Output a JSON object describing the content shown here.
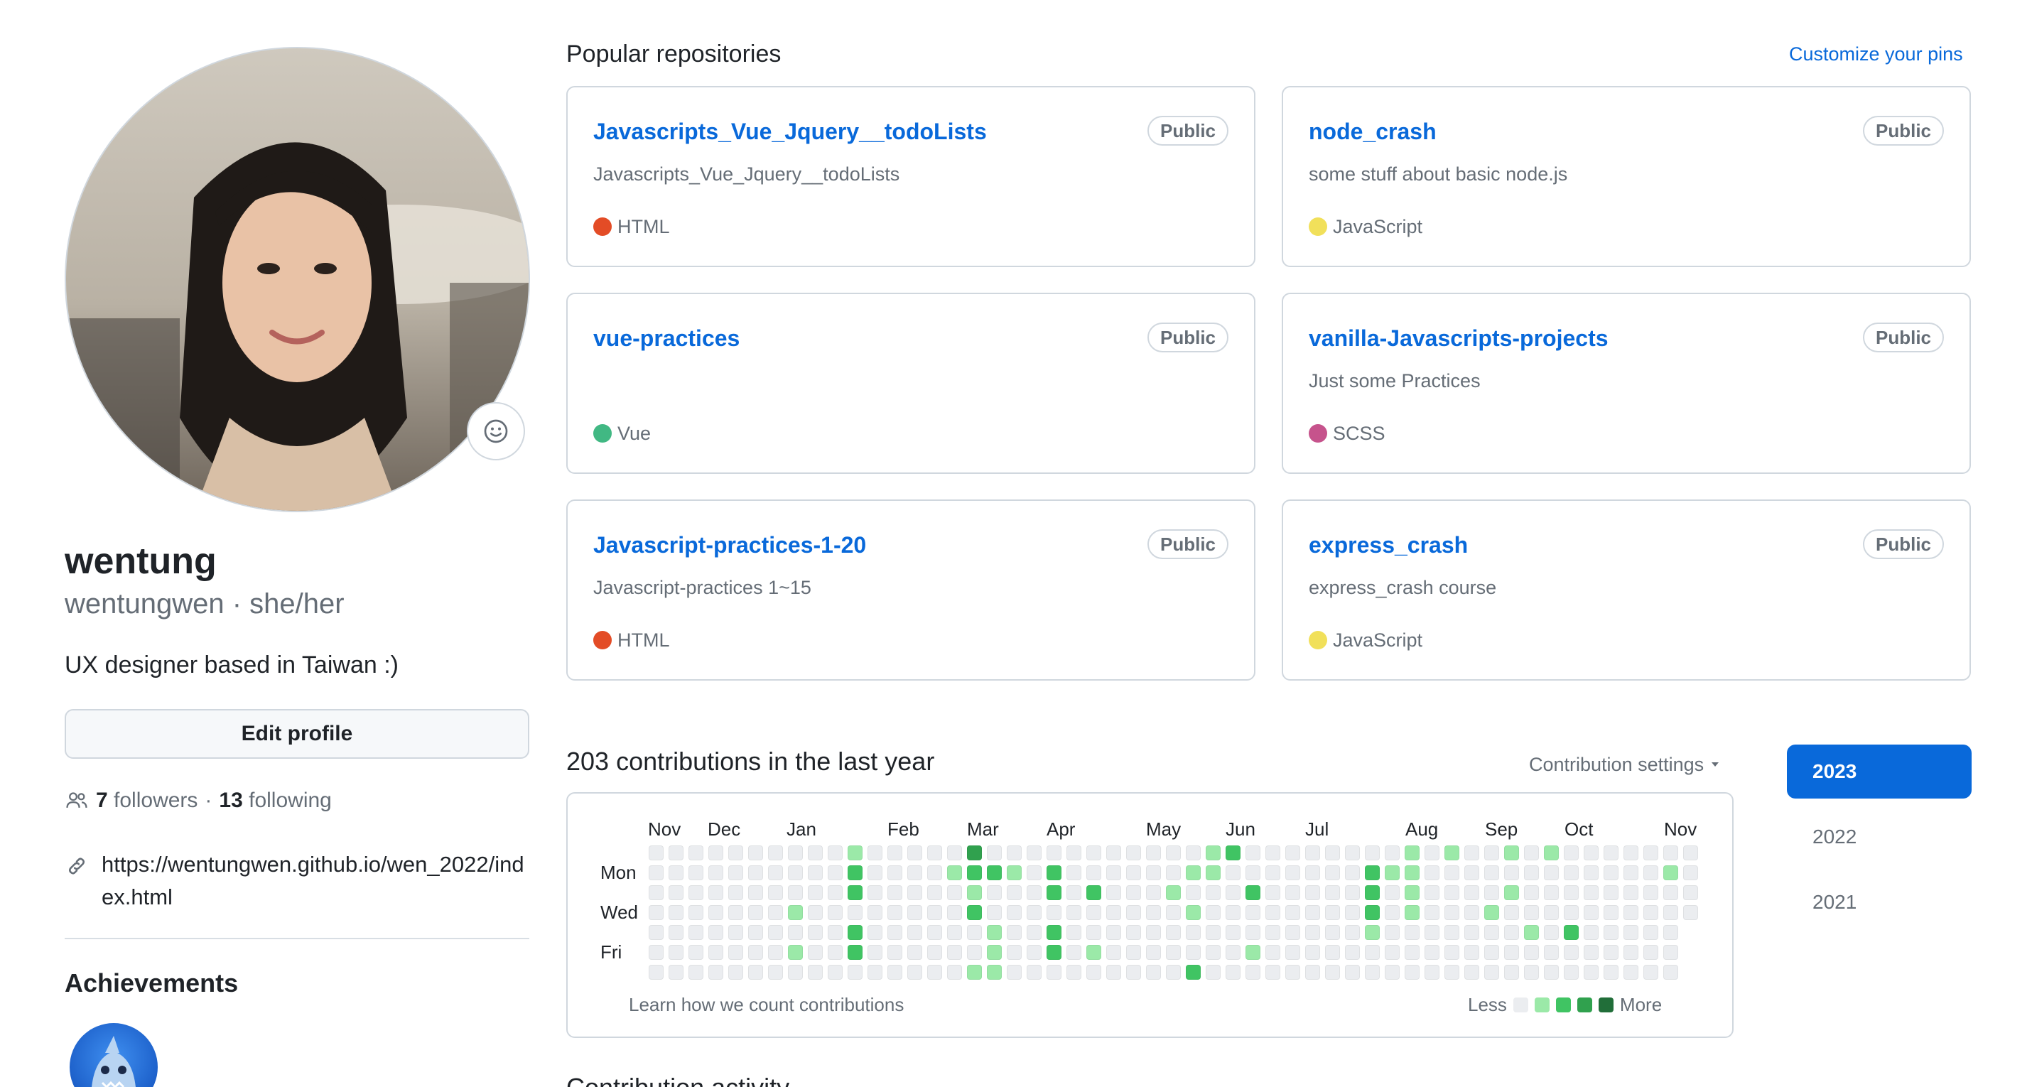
{
  "profile": {
    "name": "wentung",
    "login_line": "wentungwen · she/her",
    "bio": "UX designer based in Taiwan :)",
    "edit_label": "Edit profile",
    "followers_count": "7",
    "followers_label": "followers",
    "separator": "·",
    "following_count": "13",
    "following_label": "following",
    "website": "https://wentungwen.github.io/wen_2022/index.html",
    "achievements_title": "Achievements"
  },
  "popular": {
    "title": "Popular repositories",
    "customize_label": "Customize your pins",
    "repos": [
      {
        "name": "Javascripts_Vue_Jquery__todoLists",
        "visibility": "Public",
        "description": "Javascripts_Vue_Jquery__todoLists",
        "language": "HTML",
        "lang_color": "#e34c26"
      },
      {
        "name": "node_crash",
        "visibility": "Public",
        "description": "some stuff about basic node.js",
        "language": "JavaScript",
        "lang_color": "#f1e05a"
      },
      {
        "name": "vue-practices",
        "visibility": "Public",
        "description": "",
        "language": "Vue",
        "lang_color": "#41b883"
      },
      {
        "name": "vanilla-Javascripts-projects",
        "visibility": "Public",
        "description": "Just some Practices",
        "language": "SCSS",
        "lang_color": "#c6538c"
      },
      {
        "name": "Javascript-practices-1-20",
        "visibility": "Public",
        "description": "Javascript-practices 1~15",
        "language": "HTML",
        "lang_color": "#e34c26"
      },
      {
        "name": "express_crash",
        "visibility": "Public",
        "description": "express_crash course",
        "language": "JavaScript",
        "lang_color": "#f1e05a"
      }
    ]
  },
  "contributions": {
    "title": "203 contributions in the last year",
    "settings_label": "Contribution settings",
    "months": [
      "Nov",
      "Dec",
      "Jan",
      "Feb",
      "Mar",
      "Apr",
      "May",
      "Jun",
      "Jul",
      "Aug",
      "Sep",
      "Oct",
      "Nov"
    ],
    "days": [
      "Mon",
      "Wed",
      "Fri"
    ],
    "learn_label": "Learn how we count contributions",
    "legend_less": "Less",
    "legend_more": "More",
    "colors": [
      "#ebedf0",
      "#9be9a8",
      "#40c463",
      "#30a14e",
      "#216e39"
    ],
    "levels": [
      "0000000",
      "0000000",
      "0000000",
      "0000000",
      "0000000",
      "0000000",
      "0000000",
      "0001010",
      "0000000",
      "0000000",
      "1220220",
      "0000000",
      "0000000",
      "0000000",
      "0000000",
      "0100000",
      "3212001",
      "0200111",
      "0100000",
      "0000000",
      "0220220",
      "0000000",
      "0020010",
      "0000000",
      "0000000",
      "0000000",
      "0010000",
      "0101002",
      "1100000",
      "2000000",
      "0020010",
      "0000000",
      "0000000",
      "0000000",
      "0000000",
      "0000000",
      "0222100",
      "0100000",
      "1111000",
      "0000000",
      "1000000",
      "0000000",
      "0001000",
      "1010000",
      "0000100",
      "1000000",
      "0000200",
      "0000000",
      "0000000",
      "0000000",
      "0000000",
      "0100000",
      "0000000",
      "0000000",
      "0000000",
      "0000000",
      "1000000",
      "0000000",
      "0000000",
      "0000000",
      "0000000",
      "0000000",
      "0000000",
      "0000000",
      "0000000",
      "0000000",
      "0000000",
      "0000000",
      "0000000",
      "0000000",
      "0000000",
      "0000000",
      "0000000",
      "0000000",
      "0000000",
      "0000000",
      "0000000",
      "0000000",
      "0000000",
      "0000000",
      "0000000",
      "0000000",
      "0000000",
      "0000000",
      "0000000",
      "0000000",
      "0000000",
      "0000000",
      "0000000",
      "0000000",
      "0000000",
      "0000000",
      "0000000",
      "0000000",
      "0000000",
      "0000000",
      "0000000",
      "0000000",
      "0000000",
      "0000000"
    ],
    "years": [
      "2023",
      "2022",
      "2021"
    ],
    "active_year": "2023"
  },
  "icons": {
    "emoji": "smiley-icon",
    "people": "people-icon",
    "link": "link-icon",
    "caret": "caret-down-icon",
    "badge": "shark-achievement-icon"
  },
  "activity_title": "Contribution activity"
}
